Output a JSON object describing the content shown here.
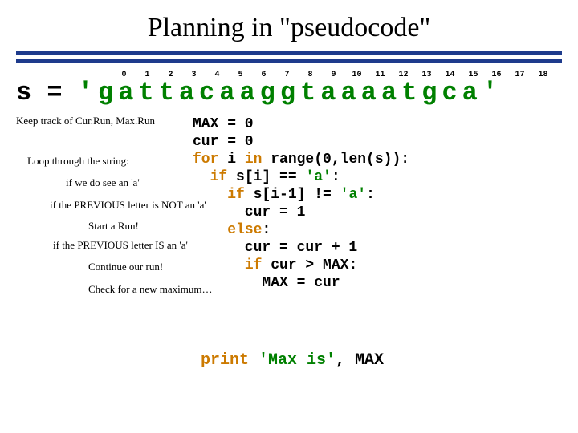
{
  "title": "Planning in \"pseudocode\"",
  "indices": [
    "0",
    "1",
    "2",
    "3",
    "4",
    "5",
    "6",
    "7",
    "8",
    "9",
    "10",
    "11",
    "12",
    "13",
    "14",
    "15",
    "16",
    "17",
    "18"
  ],
  "s_label": "s = ",
  "s_value": "'gattacaaggtaaaatgca'",
  "notes": {
    "n1": "Keep track of Cur.Run, Max.Run",
    "n2": "Loop through the string:",
    "n3": "if we do see an 'a'",
    "n4": "if the PREVIOUS letter is NOT an 'a'",
    "n5": "Start a Run!",
    "n6": "if the PREVIOUS letter IS an 'a'",
    "n7": "Continue our run!",
    "n8": "Check for a new maximum…"
  },
  "code": {
    "l1a": "MAX = 0",
    "l2a": "cur = 0",
    "l3a": "for",
    "l3b": " i ",
    "l3c": "in",
    "l3d": " range(0,len(s)):",
    "l4a": "  ",
    "l4b": "if",
    "l4c": " s[i] == ",
    "l4d": "'a'",
    "l4e": ":",
    "l5a": "    ",
    "l5b": "if",
    "l5c": " s[i-1] != ",
    "l5d": "'a'",
    "l5e": ":",
    "l6a": "      cur = 1",
    "l7a": "    ",
    "l7b": "else",
    "l7c": ":",
    "l8a": "      cur = cur + 1",
    "l9a": "      ",
    "l9b": "if",
    "l9c": " cur > MAX:",
    "l10a": "        MAX = cur"
  },
  "print": {
    "kw": "print",
    "rest": " ",
    "str": "'Max is'",
    "tail": ", MAX"
  }
}
